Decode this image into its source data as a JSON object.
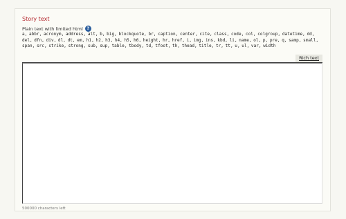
{
  "field": {
    "title": "Story text",
    "format_hint": "Plain text with limited html",
    "help_icon_glyph": "?",
    "allowed_tags": "a, abbr, acronym, address, alt, b, big, blockquote, br, caption, center, cite, class, code, col, colgroup, datetime, dd, del, dfn, div, dl, dt, em, h1, h2, h3, h4, h5, h6, height, hr, href, i, img, ins, kbd, li, name, ol, p, pre, q, samp, small, span, src, strike, strong, sub, sup, table, tbody, td, tfoot, th, thead, title, tr, tt, u, ul, var, width",
    "rich_text_label": "Rich text",
    "editor_value": "",
    "characters_left": "500000 characters left"
  },
  "colors": {
    "title": "#b3262c",
    "help_icon": "#2d5f9e",
    "background": "#f7f7f2"
  }
}
